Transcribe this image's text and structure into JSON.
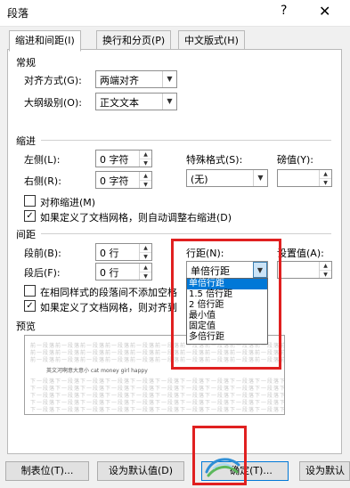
{
  "window": {
    "title": "段落",
    "help_label": "?",
    "close_label": "✕"
  },
  "tabs": [
    {
      "label": "缩进和间距(I)",
      "active": true
    },
    {
      "label": "换行和分页(P)",
      "active": false
    },
    {
      "label": "中文版式(H)",
      "active": false
    }
  ],
  "general": {
    "header": "常规",
    "alignment_label": "对齐方式(G):",
    "alignment_value": "两端对齐",
    "outline_label": "大纲级别(O):",
    "outline_value": "正文文本"
  },
  "indent": {
    "header": "缩进",
    "left_label": "左侧(L):",
    "left_value": "0 字符",
    "right_label": "右侧(R):",
    "right_value": "0 字符",
    "special_label": "特殊格式(S):",
    "special_value": "(无)",
    "measure_label": "磅值(Y):",
    "measure_value": "",
    "mirror_label": "对称缩进(M)",
    "mirror_checked": false,
    "auto_adjust_label": "如果定义了文档网格，则自动调整右缩进(D)",
    "auto_adjust_checked": true
  },
  "spacing": {
    "header": "间距",
    "before_label": "段前(B):",
    "before_value": "0 行",
    "after_label": "段后(F):",
    "after_value": "0 行",
    "line_label": "行距(N):",
    "line_value": "单倍行距",
    "setting_label": "设置值(A):",
    "setting_value": "",
    "no_space_label": "在相同样式的段落间不添加空格",
    "no_space_checked": false,
    "snap_label": "如果定义了文档网格，则对齐到",
    "snap_checked": true,
    "line_options": [
      "单倍行距",
      "1.5 倍行距",
      "2 倍行距",
      "最小值",
      "固定值",
      "多倍行距"
    ]
  },
  "preview": {
    "header": "预览",
    "prev_text": "前一段落前一段落前一段落前一段落前一段落前一段落前一段落前一段落前一段落前一段落前一段落",
    "sample_text": "英文河啊意大意小 cat money girl happy",
    "next_text": "下一段落下一段落下一段落下一段落下一段落下一段落下一段落下一段落下一段落下一段落下一段落"
  },
  "buttons": {
    "tabs_label": "制表位(T)...",
    "default_label": "设为默认值(D)",
    "ok_label": "确定",
    "ok_suffix": "(T)...",
    "default2_label": "设为默认"
  },
  "colors": {
    "highlight": "#0078d7",
    "annotation": "#e02020",
    "panel": "#ffffff"
  }
}
